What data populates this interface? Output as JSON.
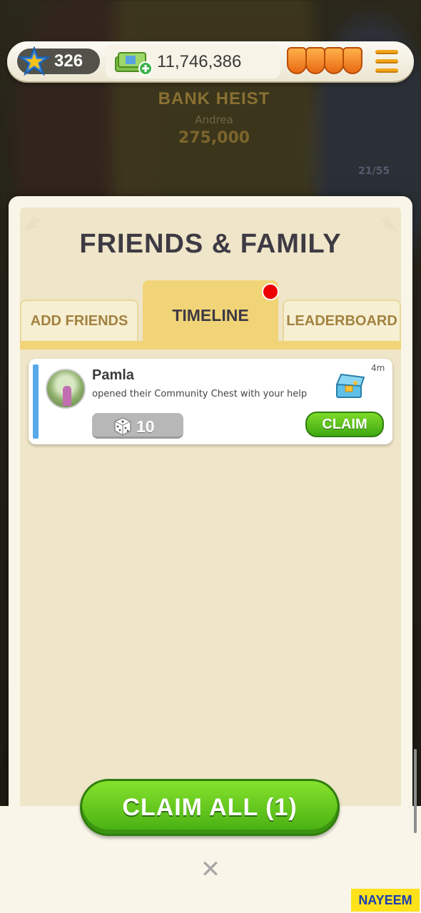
{
  "hud": {
    "level": "326",
    "cash": "11,746,386",
    "shield_count": 4
  },
  "background": {
    "event_title": "BANK HEIST",
    "event_player": "Andrea",
    "event_amount": "275,000",
    "progress_text": "21/55"
  },
  "panel": {
    "title": "FRIENDS & FAMILY",
    "tabs": [
      {
        "label": "ADD FRIENDS",
        "active": false
      },
      {
        "label": "TIMELINE",
        "active": true
      },
      {
        "label": "LEADERBOARD",
        "active": false
      }
    ]
  },
  "timeline": [
    {
      "name": "Pamla",
      "message": "opened their Community Chest with your help",
      "time": "4m",
      "reward": "10",
      "claim_label": "CLAIM"
    }
  ],
  "footer": {
    "claim_all_label": "CLAIM ALL (1)",
    "close_symbol": "✕"
  },
  "watermark": "NAYEEM",
  "colors": {
    "accent_green": "#46ae12",
    "tab_active": "#f1d477",
    "notification": "#ee0000",
    "card_accent": "#57a9ea"
  }
}
